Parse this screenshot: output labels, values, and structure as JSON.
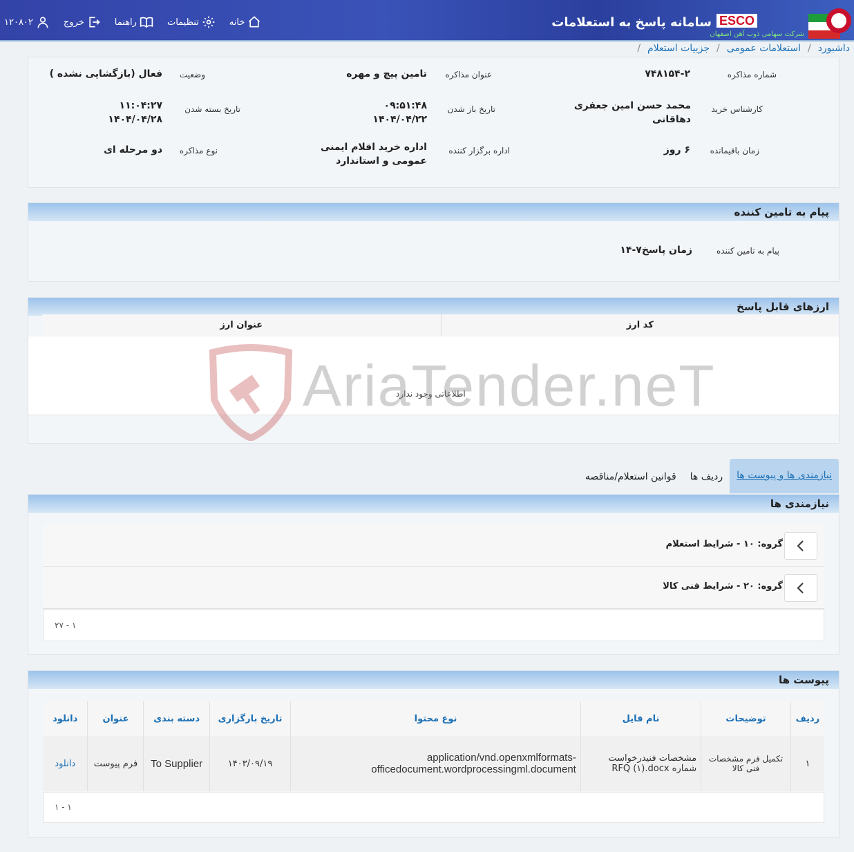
{
  "header": {
    "app_title": "سامانه پاسخ به استعلامات",
    "logo_text": "ESCO",
    "company_name": "شرکت سهامی ذوب آهن اصفهان",
    "nav": {
      "home": "خانه",
      "settings": "تنظیمات",
      "guide": "راهنما",
      "logout": "خروج",
      "user_id": "۱۲۰۸۰۲"
    }
  },
  "breadcrumb": [
    "داشبورد",
    "استعلامات عمومی",
    "جزییات استعلام"
  ],
  "details": {
    "negotiation_number_label": "شماره مذاکره",
    "negotiation_number": "۷۴۸۱۵۴-۲",
    "negotiation_title_label": "عنوان مذاکره",
    "negotiation_title": "تامین پیچ و مهره",
    "status_label": "وضعیت",
    "status": "فعال (بازگشایی نشده )",
    "buyer_label": "کارشناس خرید",
    "buyer": "محمد حسن امین جعفری دهاقانی",
    "open_date_label": "تاریخ باز شدن",
    "open_time": "۰۹:۵۱:۴۸",
    "open_date": "۱۴۰۴/۰۴/۲۲",
    "close_date_label": "تاریخ بسته شدن",
    "close_time": "۱۱:۰۴:۲۷",
    "close_date": "۱۴۰۴/۰۴/۲۸",
    "remaining_label": "زمان باقیمانده",
    "remaining": "۶ روز",
    "organizer_label": "اداره برگزار کننده",
    "organizer": "اداره خرید اقلام ایمنی عمومی و استاندارد",
    "type_label": "نوع مذاکره",
    "type": "دو مرحله ای"
  },
  "supplier_message": {
    "title": "پیام به تامین کننده",
    "field_label": "پیام به تامین کننده",
    "value": "زمان پاسخ۷-۱۴"
  },
  "currencies": {
    "title": "ارزهای قابل پاسخ",
    "columns": [
      "کد ارز",
      "عنوان ارز"
    ],
    "empty": "اطلاعاتی وجود ندارد"
  },
  "watermark": "AriaTender.neT",
  "tabs": [
    "نیازمندی ها و پیوست ها",
    "ردیف ها",
    "قوانین استعلام/مناقصه"
  ],
  "needs": {
    "title": "نیازمندی ها",
    "groups": [
      "گروه: ۱۰ - شرایط استعلام",
      "گروه: ۲۰ - شرایط فنی کالا"
    ],
    "pager": "۱ - ۲۷"
  },
  "attachments": {
    "title": "پیوست ها",
    "columns": [
      "ردیف",
      "توضیحات",
      "نام فایل",
      "نوع محتوا",
      "تاریخ بارگزاری",
      "دسته بندی",
      "عنوان",
      "دانلود"
    ],
    "rows": [
      {
        "row": "۱",
        "description": "تکمیل فرم مشخصات فنی کالا",
        "file_name": "مشخصات فنیدرخواست شماره RFQ (۱).docx",
        "content_type": "application/vnd.openxmlformats-officedocument.wordprocessingml.document",
        "upload_date": "۱۴۰۳/۰۹/۱۹",
        "category": "To Supplier",
        "title": "فرم پیوست",
        "download": "دانلود"
      }
    ],
    "pager": "۱ - ۱"
  },
  "colors": {
    "header_bg": "#3343a8",
    "link": "#1a6fb5",
    "panel_head": "#9dc3ea",
    "brand_red": "#d0102a"
  }
}
